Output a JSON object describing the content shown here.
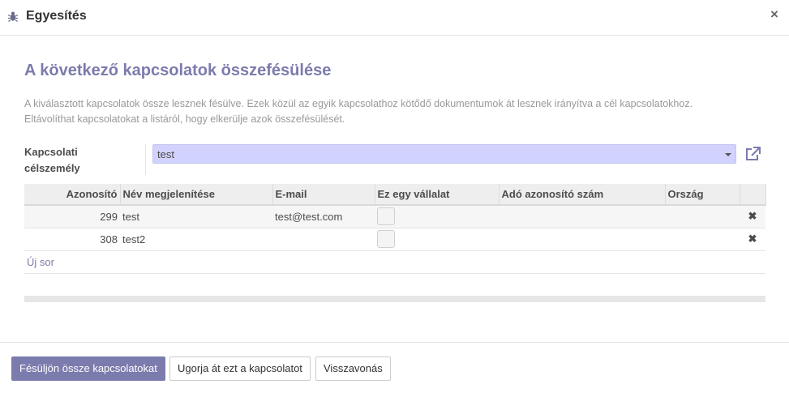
{
  "dialog": {
    "title": "Egyesítés",
    "icon": "bug-icon",
    "close_icon": "×"
  },
  "content": {
    "heading": "A következő kapcsolatok összefésülése",
    "description_line1": "A kiválasztott kapcsolatok össze lesznek fésülve. Ezek közül az egyik kapcsolathoz kötődő dokumentumok át lesznek irányítva a cél kapcsolatokhoz.",
    "description_line2": "Eltávolíthat kapcsolatokat a listáról, hogy elkerülje azok összefésülését.",
    "destination_label_line1": "Kapcsolati",
    "destination_label_line2": "célszemély",
    "destination_value": "test"
  },
  "table": {
    "columns": [
      "Azonosító",
      "Név megjelenítése",
      "E-mail",
      "Ez egy vállalat",
      "Adó azonosító szám",
      "Ország"
    ],
    "rows": [
      {
        "id": "299",
        "name": "test",
        "email": "test@test.com",
        "is_company": false,
        "vat": "",
        "country": ""
      },
      {
        "id": "308",
        "name": "test2",
        "email": "",
        "is_company": false,
        "vat": "",
        "country": ""
      }
    ],
    "add_row_label": "Új sor",
    "delete_icon": "✖"
  },
  "footer": {
    "merge_button": "Fésüljön össze kapcsolatokat",
    "skip_button": "Ugorja át ezt a kapcsolatot",
    "cancel_button": "Visszavonás"
  },
  "colors": {
    "accent": "#7c7bad",
    "selection_bg": "#d2d2ff"
  }
}
